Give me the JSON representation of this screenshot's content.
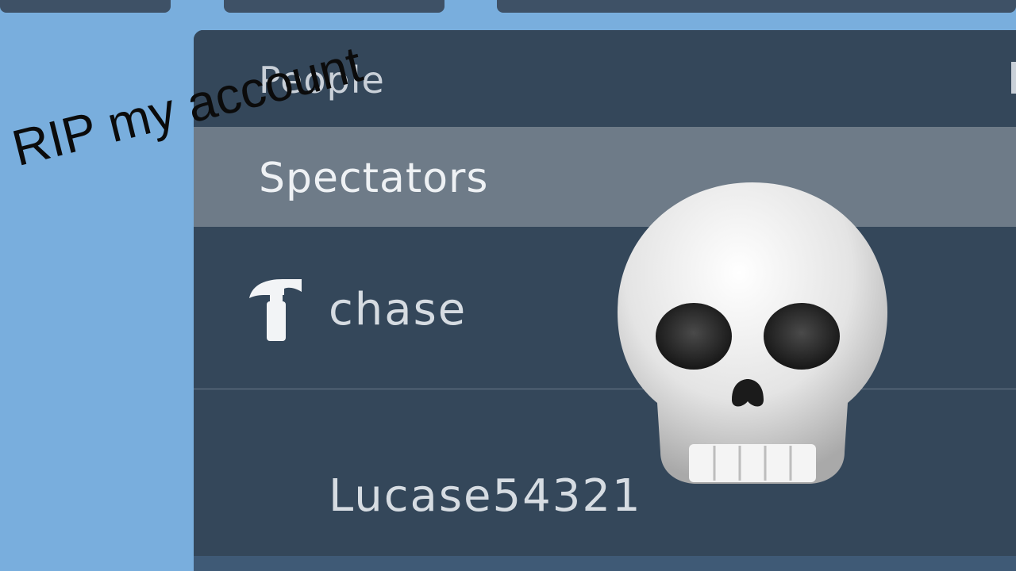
{
  "panel": {
    "header_label": "People",
    "section_label": "Spectators",
    "rows": [
      {
        "username": "chase",
        "icon": "hammer-icon"
      },
      {
        "username": "Lucase54321"
      }
    ]
  },
  "overlay": {
    "caption": "RIP my account",
    "sticker_icon": "skull-icon"
  },
  "colors": {
    "background": "#79aedd",
    "panel": "#34475a",
    "section_bar": "#6e7b88",
    "text_light": "#d6dce2",
    "caption_text": "#0b0b0b"
  }
}
